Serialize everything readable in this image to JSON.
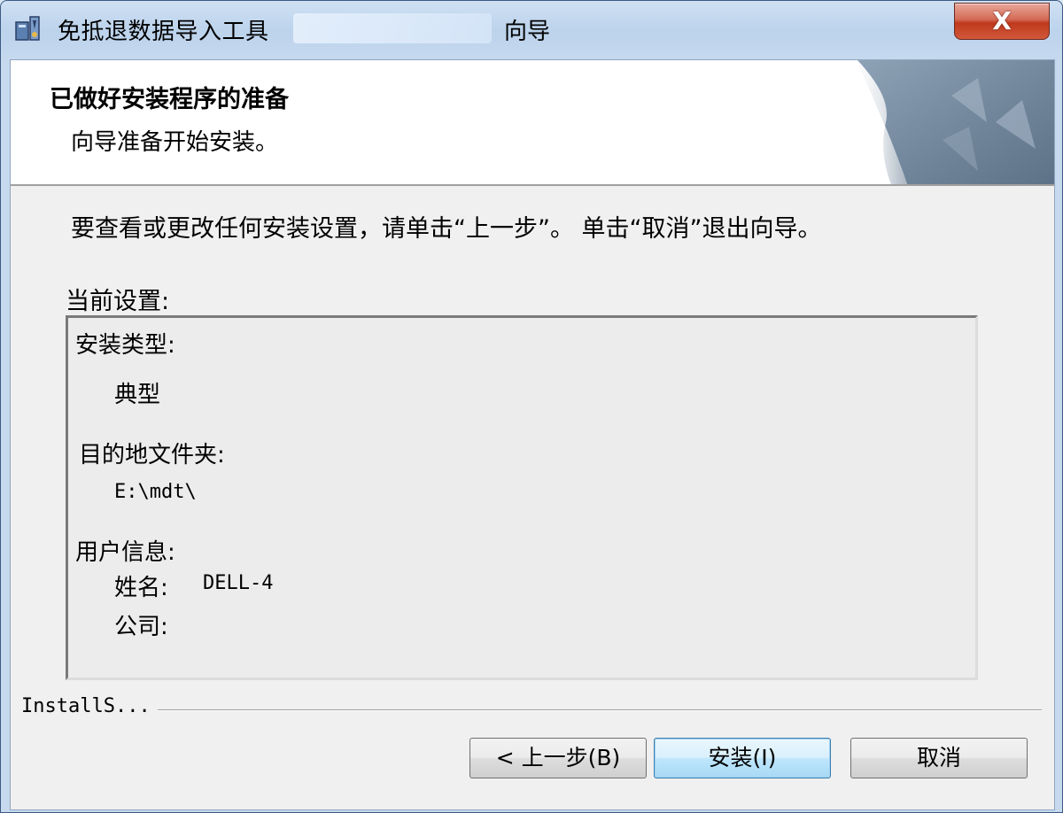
{
  "window": {
    "title": "免抵退数据导入工具",
    "title_suffix": "向导",
    "close_label": "X"
  },
  "header": {
    "title": "已做好安装程序的准备",
    "subtitle": "向导准备开始安装。"
  },
  "main": {
    "instructions": "要查看或更改任何安装设置，请单击“上一步”。 单击“取消”退出向导。",
    "current_settings_label": "当前设置:",
    "settings": {
      "setup_type_label": "安装类型:",
      "setup_type_value": "典型",
      "destination_label": "目的地文件夹:",
      "destination_value": "E:\\mdt\\",
      "user_info_label": "用户信息:",
      "name_label": "姓名:",
      "name_value": "DELL-4",
      "company_label": "公司:",
      "company_value": ""
    }
  },
  "footer": {
    "brand": "InstallS...",
    "back_button": "< 上一步(B)",
    "install_button": "安装(I)",
    "cancel_button": "取消"
  },
  "icons": {
    "app": "installer-icon",
    "close": "close-icon",
    "header_art": "page-curl-art"
  },
  "colors": {
    "close_button": "#c0391d",
    "default_button_border": "#3c7fb1",
    "title_bar": "#bcd3ec"
  }
}
